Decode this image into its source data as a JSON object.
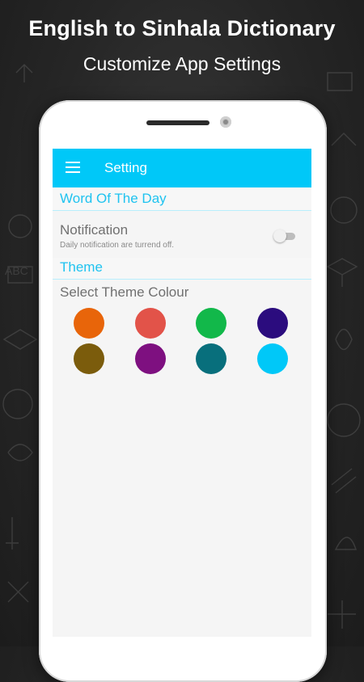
{
  "promo": {
    "headline": "English to Sinhala Dictionary",
    "subline": "Customize App Settings"
  },
  "appbar": {
    "title": "Setting",
    "menu_icon": "hamburger-menu-icon",
    "color": "#00C8F8"
  },
  "sections": {
    "word_of_the_day": "Word Of The Day",
    "theme": "Theme"
  },
  "notification": {
    "title": "Notification",
    "subtitle": "Daily notification are turrend off.",
    "enabled": false
  },
  "theme": {
    "select_label": "Select Theme Colour",
    "colors": [
      "#E8650A",
      "#E25349",
      "#12B84A",
      "#2B0C7E",
      "#7B5C0C",
      "#7E1080",
      "#086F7C",
      "#00C8F8"
    ]
  }
}
